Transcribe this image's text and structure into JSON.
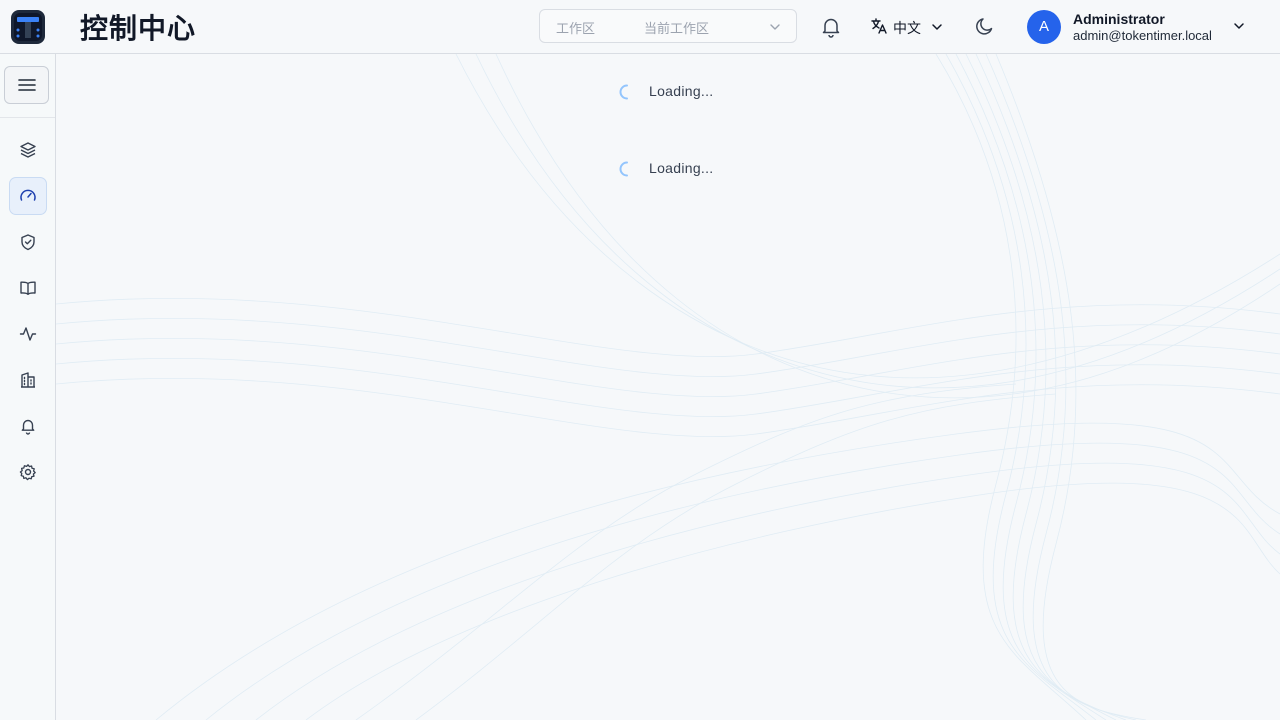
{
  "header": {
    "title": "控制中心",
    "workspace": {
      "label": "工作区",
      "value": "当前工作区"
    },
    "language": "中文",
    "user": {
      "initial": "A",
      "name": "Administrator",
      "email": "admin@tokentimer.local"
    }
  },
  "sidebar": {
    "items": [
      {
        "icon": "layers-icon",
        "active": false
      },
      {
        "icon": "gauge-icon",
        "active": true
      },
      {
        "icon": "shield-check-icon",
        "active": false
      },
      {
        "icon": "book-open-icon",
        "active": false
      },
      {
        "icon": "activity-icon",
        "active": false
      },
      {
        "icon": "building-icon",
        "active": false
      },
      {
        "icon": "bell-icon",
        "active": false
      },
      {
        "icon": "settings-icon",
        "active": false
      }
    ]
  },
  "main": {
    "loaders": [
      {
        "text": "Loading..."
      },
      {
        "text": "Loading..."
      }
    ]
  },
  "colors": {
    "accent": "#2563eb",
    "active_nav_bg": "#e8f0fb",
    "spinner": "#93c5fd",
    "border": "#d9dde3"
  }
}
